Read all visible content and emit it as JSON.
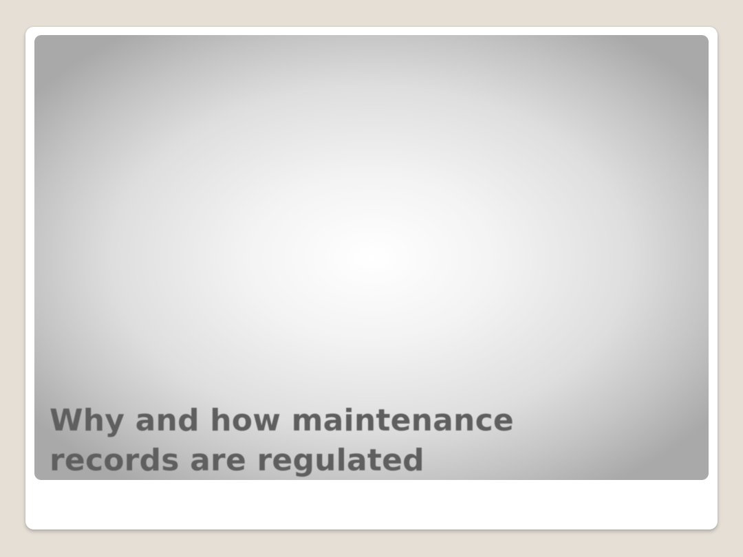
{
  "slide": {
    "title_line_1": "Why and how maintenance",
    "title_line_2": "records are regulated"
  },
  "colors": {
    "background": "#e5dfd5",
    "card": "#ffffff",
    "title_text": "#5f5f5f",
    "gradient_center": "#ffffff",
    "gradient_edge": "#a9a9a9"
  }
}
